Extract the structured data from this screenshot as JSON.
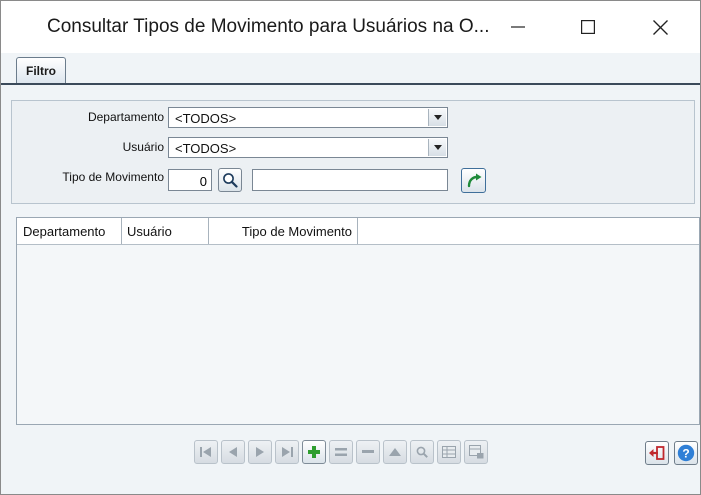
{
  "window": {
    "title": "Consultar Tipos de Movimento para Usuários na O...",
    "icons": [
      "minimize-icon",
      "maximize-icon",
      "close-icon"
    ]
  },
  "tabs": [
    {
      "label": "Filtro",
      "active": true
    }
  ],
  "filter": {
    "departamento": {
      "label": "Departamento",
      "value": "<TODOS>"
    },
    "usuario": {
      "label": "Usuário",
      "value": "<TODOS>"
    },
    "tipo_movimento": {
      "label": "Tipo de Movimento",
      "code": "0",
      "description": ""
    }
  },
  "grid": {
    "columns": [
      "Departamento",
      "Usuário",
      "Tipo de Movimento"
    ],
    "rows": []
  },
  "navigator": {
    "buttons": [
      "first-icon",
      "prior-icon",
      "next-icon",
      "last-icon",
      "insert-icon",
      "edit-icon",
      "delete-icon",
      "post-icon",
      "search-icon",
      "grid-icon",
      "export-icon"
    ]
  },
  "colors": {
    "background": "#f0f4f7",
    "tab_border": "#3b4a5a",
    "insert_green": "#2f9e2f",
    "exit_red": "#c0282d",
    "help_blue": "#2f7fd6"
  }
}
